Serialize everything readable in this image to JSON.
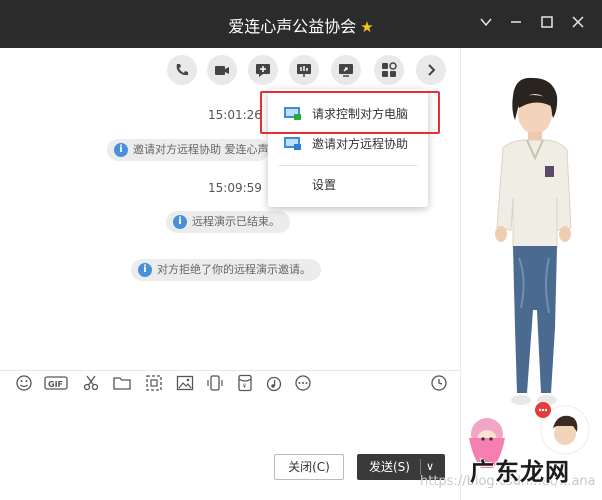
{
  "window": {
    "title": "爱连心声公益协会"
  },
  "messages": {
    "time1": "15:01:26",
    "notice1": "邀请对方远程协助 爱连心声公益协会邀请你",
    "time2": "15:09:59",
    "notice2": "远程演示已结束。",
    "notice3": "对方拒绝了你的远程演示邀请。"
  },
  "menu": {
    "item1": "请求控制对方电脑",
    "item2": "邀请对方远程协助",
    "item3": "设置"
  },
  "buttons": {
    "close_label": "关闭(C)",
    "send_label": "发送(S)"
  },
  "branding": {
    "watermark": "https://blog.csdn.net/...ana",
    "logo_text": "广东龙网"
  },
  "colors": {
    "titlebar": "#2b2b2b",
    "highlight": "#e63030",
    "notice_icon": "#4a90d9"
  }
}
